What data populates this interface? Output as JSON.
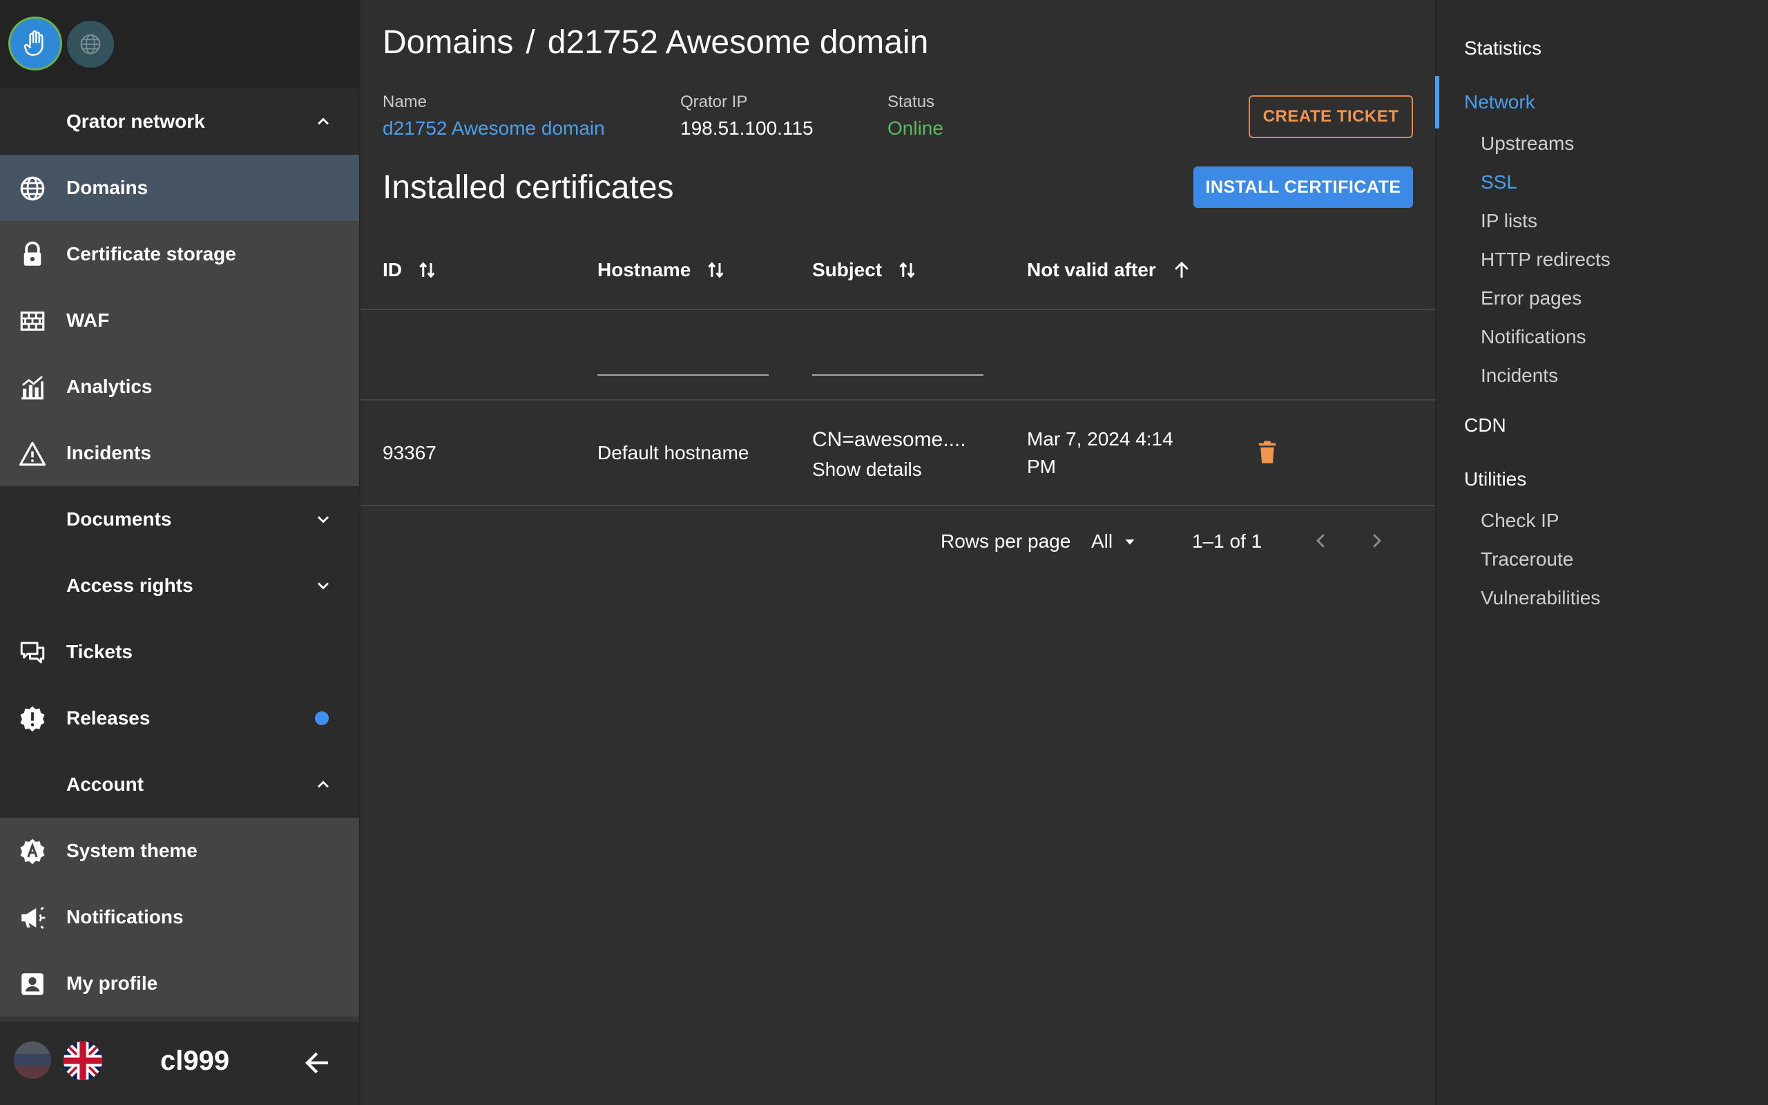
{
  "sidebar": {
    "groups": {
      "qrator_network": "Qrator network",
      "documents": "Documents",
      "access_rights": "Access rights",
      "account": "Account"
    },
    "items": {
      "domains": "Domains",
      "certificate_storage": "Certificate storage",
      "waf": "WAF",
      "analytics": "Analytics",
      "incidents": "Incidents",
      "tickets": "Tickets",
      "releases": "Releases",
      "system_theme": "System theme",
      "notifications": "Notifications",
      "my_profile": "My profile"
    },
    "footer": {
      "username": "cl999"
    }
  },
  "header": {
    "breadcrumb_root": "Domains",
    "breadcrumb_sep": "/",
    "breadcrumb_current": "d21752 Awesome domain"
  },
  "domain_info": {
    "name_label": "Name",
    "name_value": "d21752 Awesome domain",
    "ip_label": "Qrator IP",
    "ip_value": "198.51.100.115",
    "status_label": "Status",
    "status_value": "Online"
  },
  "actions": {
    "create_ticket": "CREATE TICKET",
    "install_certificate": "INSTALL CERTIFICATE"
  },
  "certificates": {
    "title": "Installed certificates",
    "columns": {
      "id": "ID",
      "hostname": "Hostname",
      "subject": "Subject",
      "not_valid_after": "Not valid after"
    },
    "rows": [
      {
        "id": "93367",
        "hostname": "Default hostname",
        "subject": "CN=awesome....",
        "subject_details": "Show details",
        "not_valid_after_line1": "Mar 7, 2024 4:14",
        "not_valid_after_line2": "PM"
      }
    ]
  },
  "pagination": {
    "rows_per_page_label": "Rows per page",
    "rows_per_page_value": "All",
    "range": "1–1 of 1"
  },
  "rightnav": {
    "statistics": "Statistics",
    "network": "Network",
    "network_items": [
      "Upstreams",
      "SSL",
      "IP lists",
      "HTTP redirects",
      "Error pages",
      "Notifications",
      "Incidents"
    ],
    "cdn": "CDN",
    "utilities": "Utilities",
    "utilities_items": [
      "Check IP",
      "Traceroute",
      "Vulnerabilities"
    ]
  },
  "colors": {
    "accent": "#4a9eee",
    "warning": "#f0954b",
    "online": "#5cb85c",
    "sidebar_active": "#455362"
  }
}
